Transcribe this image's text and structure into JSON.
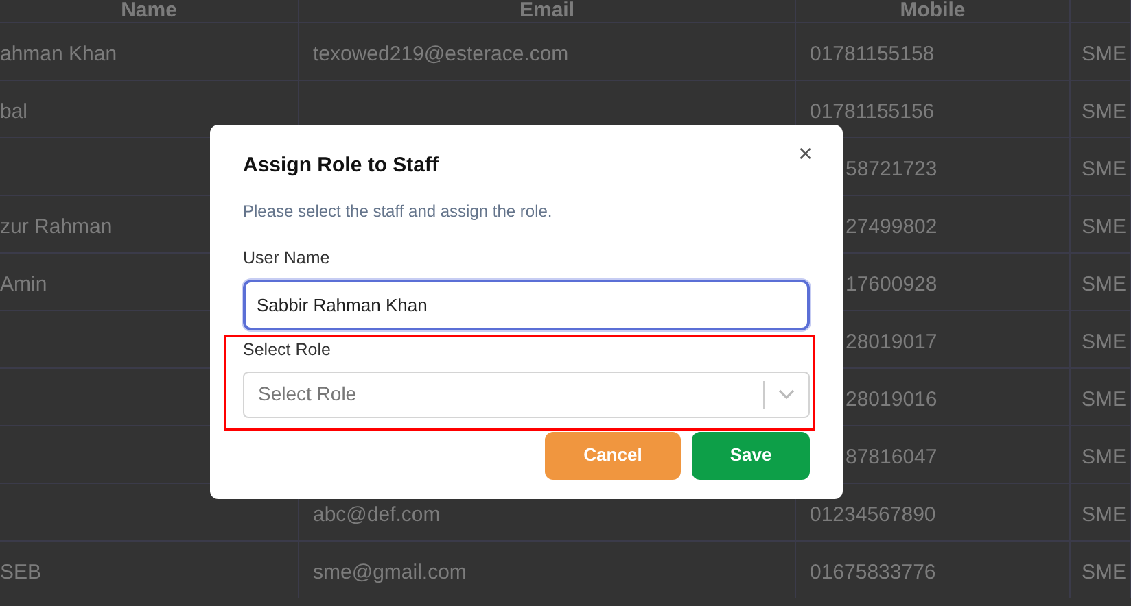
{
  "table": {
    "columns": [
      "Name",
      "Email",
      "Mobile"
    ],
    "rows": [
      {
        "cells": [
          "ahman Khan",
          "texowed219@esterace.com",
          "01781155158",
          "SME"
        ],
        "partly_hidden": false
      },
      {
        "cells": [
          "bal",
          "",
          "01781155156",
          "SME"
        ],
        "partly_hidden": false
      },
      {
        "cells": [
          "",
          "",
          "58721723",
          "SME"
        ],
        "partly_hidden": true
      },
      {
        "cells": [
          "zur Rahman",
          "",
          "27499802",
          "SME"
        ],
        "partly_hidden": true
      },
      {
        "cells": [
          "Amin",
          "",
          "17600928",
          "SME"
        ],
        "partly_hidden": true
      },
      {
        "cells": [
          "",
          "",
          "28019017",
          "SME"
        ],
        "partly_hidden": true
      },
      {
        "cells": [
          "",
          "",
          "28019016",
          "SME"
        ],
        "partly_hidden": true
      },
      {
        "cells": [
          "",
          "",
          "87816047",
          "SME"
        ],
        "partly_hidden": true
      },
      {
        "cells": [
          "",
          "abc@def.com",
          "01234567890",
          "SME"
        ],
        "partly_hidden": false
      },
      {
        "cells": [
          "SEB",
          "sme@gmail.com",
          "01675833776",
          "SME"
        ],
        "partly_hidden": false
      }
    ]
  },
  "dialog": {
    "title": "Assign Role to Staff",
    "close": "×",
    "description": "Please select the staff and assign the role.",
    "fields": [
      {
        "kind": "text",
        "label": "User Name",
        "value": "Sabbir Rahman Khan",
        "focused": true,
        "highlighted": false
      },
      {
        "kind": "select",
        "label": "Select Role",
        "placeholder": "Select Role",
        "focused": false,
        "highlighted": true
      }
    ],
    "buttons": [
      {
        "kind": "cancel",
        "label": "Cancel"
      },
      {
        "kind": "save",
        "label": "Save"
      }
    ]
  }
}
